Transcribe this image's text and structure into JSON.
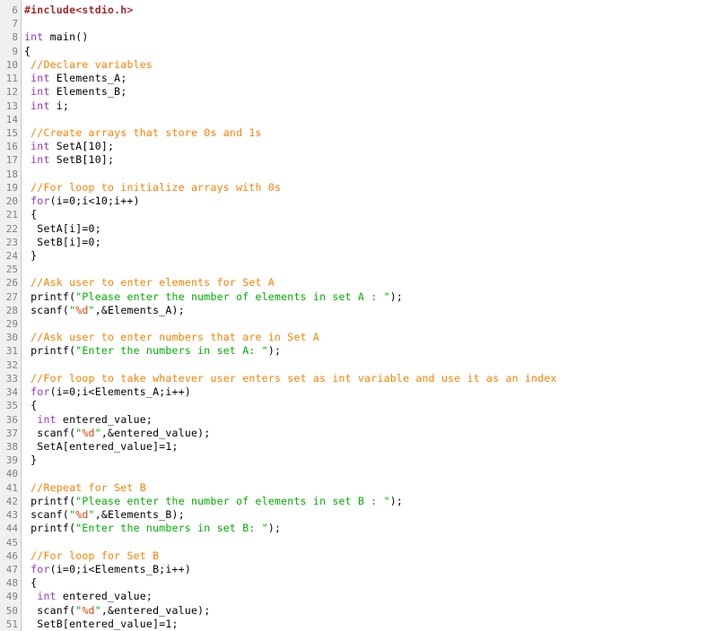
{
  "editor": {
    "language": "C",
    "first_line_number": 6,
    "last_line_number": 51,
    "colors": {
      "background": "#ffffff",
      "gutter_background": "#f0f0f0",
      "gutter_text": "#808080",
      "gutter_border": "#c8c8c8",
      "preprocessor": "#a52a2a",
      "keyword": "#9933cc",
      "comment": "#ff8000",
      "string": "#00b000",
      "format_specifier": "#e04000",
      "plain_text": "#000000"
    }
  },
  "lines": [
    {
      "number": "6",
      "tokens": [
        {
          "t": "#include<stdio.h>",
          "c": "pre"
        }
      ]
    },
    {
      "number": "7",
      "tokens": []
    },
    {
      "number": "8",
      "tokens": [
        {
          "t": "int",
          "c": "kw"
        },
        {
          "t": " main()",
          "c": "plain"
        }
      ]
    },
    {
      "number": "9",
      "tokens": [
        {
          "t": "{",
          "c": "plain"
        }
      ]
    },
    {
      "number": "10",
      "tokens": [
        {
          "t": " ",
          "c": "plain"
        },
        {
          "t": "//Declare variables",
          "c": "cmt"
        }
      ]
    },
    {
      "number": "11",
      "tokens": [
        {
          "t": " ",
          "c": "plain"
        },
        {
          "t": "int",
          "c": "kw"
        },
        {
          "t": " Elements_A;",
          "c": "plain"
        }
      ]
    },
    {
      "number": "12",
      "tokens": [
        {
          "t": " ",
          "c": "plain"
        },
        {
          "t": "int",
          "c": "kw"
        },
        {
          "t": " Elements_B;",
          "c": "plain"
        }
      ]
    },
    {
      "number": "13",
      "tokens": [
        {
          "t": " ",
          "c": "plain"
        },
        {
          "t": "int",
          "c": "kw"
        },
        {
          "t": " i;",
          "c": "plain"
        }
      ]
    },
    {
      "number": "14",
      "tokens": []
    },
    {
      "number": "15",
      "tokens": [
        {
          "t": " ",
          "c": "plain"
        },
        {
          "t": "//Create arrays that store 0s and 1s",
          "c": "cmt"
        }
      ]
    },
    {
      "number": "16",
      "tokens": [
        {
          "t": " ",
          "c": "plain"
        },
        {
          "t": "int",
          "c": "kw"
        },
        {
          "t": " SetA[10];",
          "c": "plain"
        }
      ]
    },
    {
      "number": "17",
      "tokens": [
        {
          "t": " ",
          "c": "plain"
        },
        {
          "t": "int",
          "c": "kw"
        },
        {
          "t": " SetB[10];",
          "c": "plain"
        }
      ]
    },
    {
      "number": "18",
      "tokens": []
    },
    {
      "number": "19",
      "tokens": [
        {
          "t": " ",
          "c": "plain"
        },
        {
          "t": "//For loop to initialize arrays with 0s",
          "c": "cmt"
        }
      ]
    },
    {
      "number": "20",
      "tokens": [
        {
          "t": " ",
          "c": "plain"
        },
        {
          "t": "for",
          "c": "kw"
        },
        {
          "t": "(i=0;i<10;i++)",
          "c": "plain"
        }
      ]
    },
    {
      "number": "21",
      "tokens": [
        {
          "t": " {",
          "c": "plain"
        }
      ]
    },
    {
      "number": "22",
      "tokens": [
        {
          "t": "  SetA[i]=0;",
          "c": "plain"
        }
      ]
    },
    {
      "number": "23",
      "tokens": [
        {
          "t": "  SetB[i]=0;",
          "c": "plain"
        }
      ]
    },
    {
      "number": "24",
      "tokens": [
        {
          "t": " }",
          "c": "plain"
        }
      ]
    },
    {
      "number": "25",
      "tokens": []
    },
    {
      "number": "26",
      "tokens": [
        {
          "t": " ",
          "c": "plain"
        },
        {
          "t": "//Ask user to enter elements for Set A",
          "c": "cmt"
        }
      ]
    },
    {
      "number": "27",
      "tokens": [
        {
          "t": " printf(",
          "c": "plain"
        },
        {
          "t": "\"Please enter the number of elements in set A : \"",
          "c": "str"
        },
        {
          "t": ");",
          "c": "plain"
        }
      ]
    },
    {
      "number": "28",
      "tokens": [
        {
          "t": " scanf(",
          "c": "plain"
        },
        {
          "t": "\"",
          "c": "str"
        },
        {
          "t": "%d",
          "c": "fmt"
        },
        {
          "t": "\"",
          "c": "str"
        },
        {
          "t": ",&Elements_A);",
          "c": "plain"
        }
      ]
    },
    {
      "number": "29",
      "tokens": []
    },
    {
      "number": "30",
      "tokens": [
        {
          "t": " ",
          "c": "plain"
        },
        {
          "t": "//Ask user to enter numbers that are in Set A",
          "c": "cmt"
        }
      ]
    },
    {
      "number": "31",
      "tokens": [
        {
          "t": " printf(",
          "c": "plain"
        },
        {
          "t": "\"Enter the numbers in set A: \"",
          "c": "str"
        },
        {
          "t": ");",
          "c": "plain"
        }
      ]
    },
    {
      "number": "32",
      "tokens": []
    },
    {
      "number": "33",
      "tokens": [
        {
          "t": " ",
          "c": "plain"
        },
        {
          "t": "//For loop to take whatever user enters set as int variable and use it as an index",
          "c": "cmt"
        }
      ]
    },
    {
      "number": "34",
      "tokens": [
        {
          "t": " ",
          "c": "plain"
        },
        {
          "t": "for",
          "c": "kw"
        },
        {
          "t": "(i=0;i<Elements_A;i++)",
          "c": "plain"
        }
      ]
    },
    {
      "number": "35",
      "tokens": [
        {
          "t": " {",
          "c": "plain"
        }
      ]
    },
    {
      "number": "36",
      "tokens": [
        {
          "t": "  ",
          "c": "plain"
        },
        {
          "t": "int",
          "c": "kw"
        },
        {
          "t": " entered_value;",
          "c": "plain"
        }
      ]
    },
    {
      "number": "37",
      "tokens": [
        {
          "t": "  scanf(",
          "c": "plain"
        },
        {
          "t": "\"",
          "c": "str"
        },
        {
          "t": "%d",
          "c": "fmt"
        },
        {
          "t": "\"",
          "c": "str"
        },
        {
          "t": ",&entered_value);",
          "c": "plain"
        }
      ]
    },
    {
      "number": "38",
      "tokens": [
        {
          "t": "  SetA[entered_value]=1;",
          "c": "plain"
        }
      ]
    },
    {
      "number": "39",
      "tokens": [
        {
          "t": " }",
          "c": "plain"
        }
      ]
    },
    {
      "number": "40",
      "tokens": []
    },
    {
      "number": "41",
      "tokens": [
        {
          "t": " ",
          "c": "plain"
        },
        {
          "t": "//Repeat for Set B",
          "c": "cmt"
        }
      ]
    },
    {
      "number": "42",
      "tokens": [
        {
          "t": " printf(",
          "c": "plain"
        },
        {
          "t": "\"Please enter the number of elements in set B : \"",
          "c": "str"
        },
        {
          "t": ");",
          "c": "plain"
        }
      ]
    },
    {
      "number": "43",
      "tokens": [
        {
          "t": " scanf(",
          "c": "plain"
        },
        {
          "t": "\"",
          "c": "str"
        },
        {
          "t": "%d",
          "c": "fmt"
        },
        {
          "t": "\"",
          "c": "str"
        },
        {
          "t": ",&Elements_B);",
          "c": "plain"
        }
      ]
    },
    {
      "number": "44",
      "tokens": [
        {
          "t": " printf(",
          "c": "plain"
        },
        {
          "t": "\"Enter the numbers in set B: \"",
          "c": "str"
        },
        {
          "t": ");",
          "c": "plain"
        }
      ]
    },
    {
      "number": "45",
      "tokens": []
    },
    {
      "number": "46",
      "tokens": [
        {
          "t": " ",
          "c": "plain"
        },
        {
          "t": "//For loop for Set B",
          "c": "cmt"
        }
      ]
    },
    {
      "number": "47",
      "tokens": [
        {
          "t": " ",
          "c": "plain"
        },
        {
          "t": "for",
          "c": "kw"
        },
        {
          "t": "(i=0;i<Elements_B;i++)",
          "c": "plain"
        }
      ]
    },
    {
      "number": "48",
      "tokens": [
        {
          "t": " {",
          "c": "plain"
        }
      ]
    },
    {
      "number": "49",
      "tokens": [
        {
          "t": "  ",
          "c": "plain"
        },
        {
          "t": "int",
          "c": "kw"
        },
        {
          "t": " entered_value;",
          "c": "plain"
        }
      ]
    },
    {
      "number": "50",
      "tokens": [
        {
          "t": "  scanf(",
          "c": "plain"
        },
        {
          "t": "\"",
          "c": "str"
        },
        {
          "t": "%d",
          "c": "fmt"
        },
        {
          "t": "\"",
          "c": "str"
        },
        {
          "t": ",&entered_value);",
          "c": "plain"
        }
      ]
    },
    {
      "number": "51",
      "tokens": [
        {
          "t": "  SetB[entered_value]=1;",
          "c": "plain"
        }
      ]
    }
  ]
}
